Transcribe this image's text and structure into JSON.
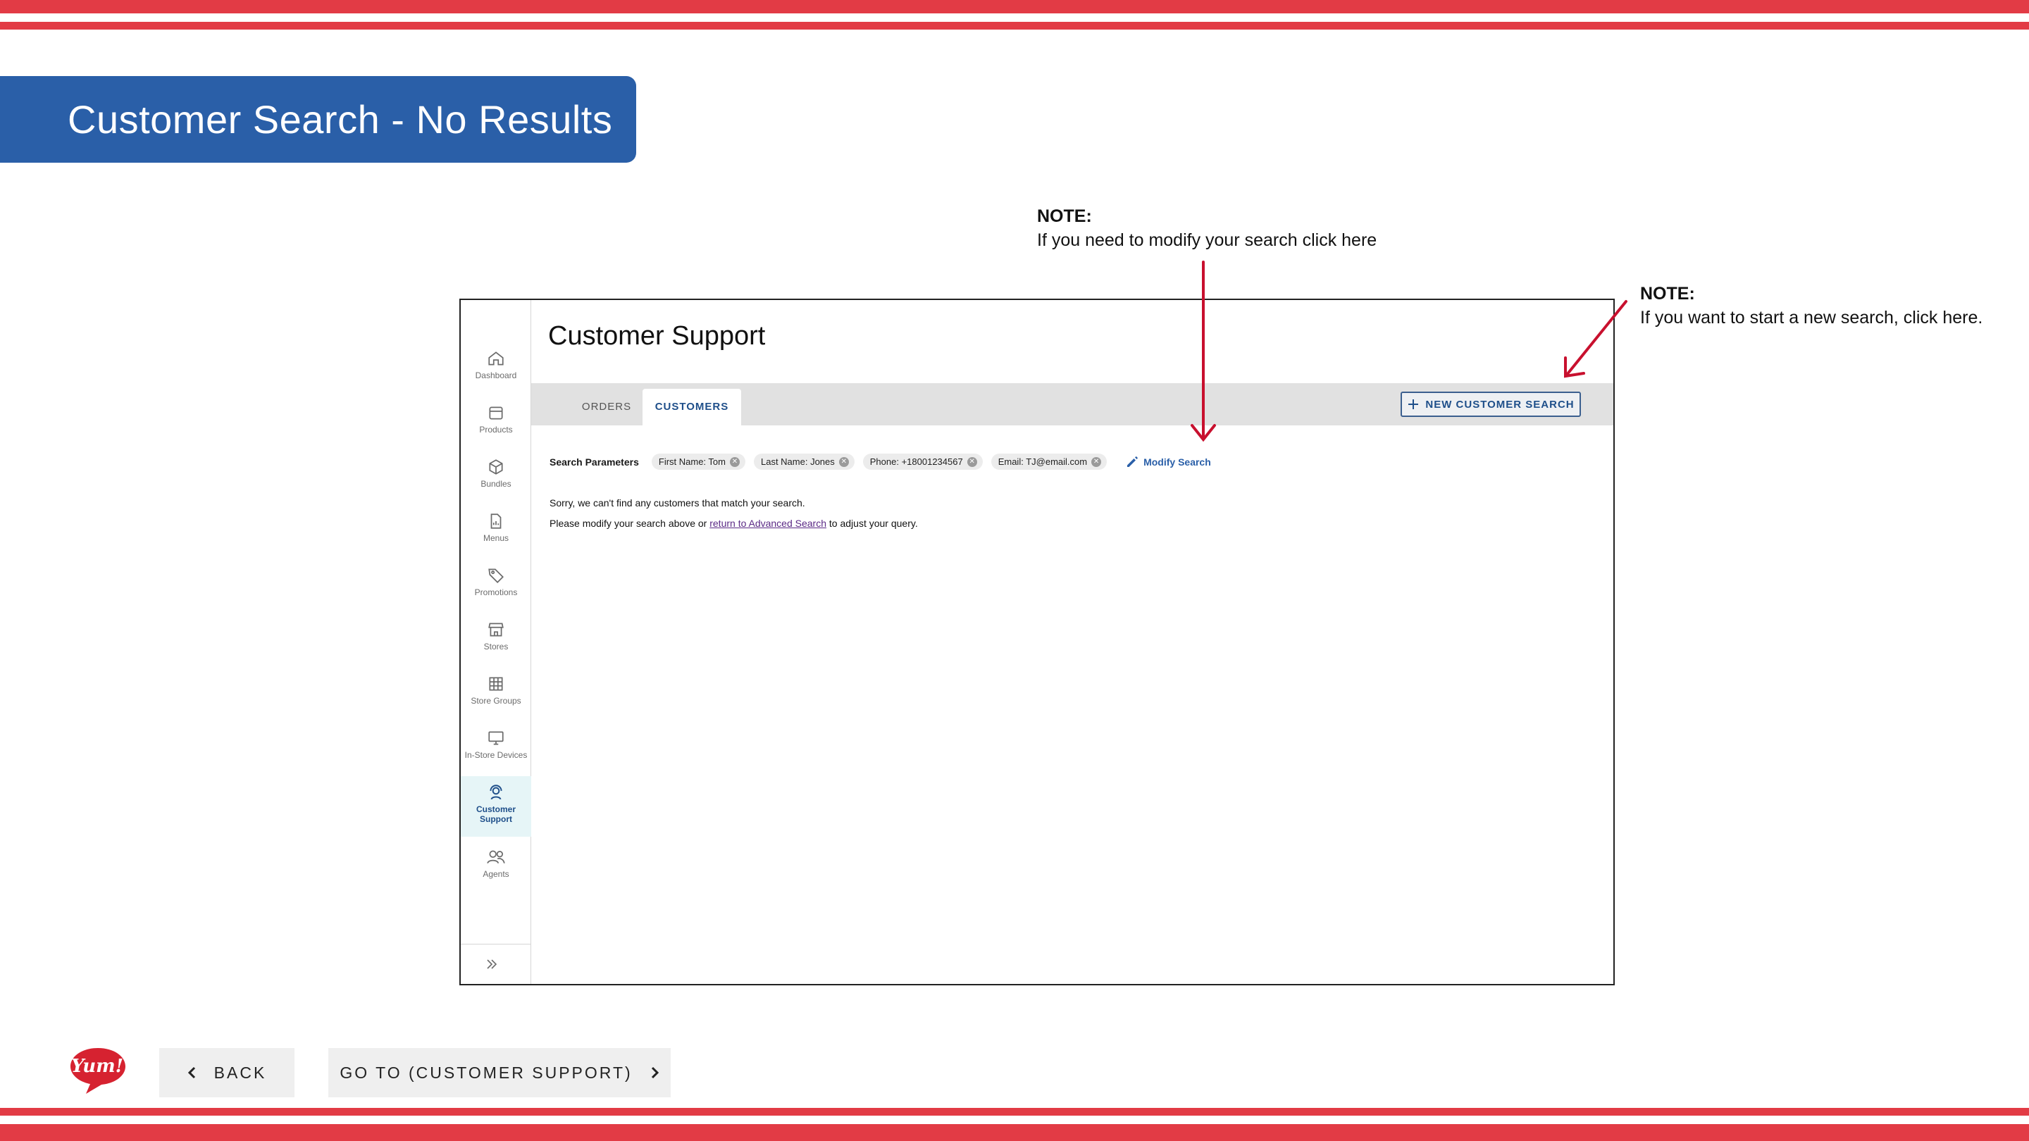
{
  "slide": {
    "title": "Customer Search - No Results",
    "notes": [
      {
        "head": "NOTE:",
        "text": "If you need to modify your search click here"
      },
      {
        "head": "NOTE:",
        "text": "If you want to start a new search, click here."
      }
    ],
    "colors": {
      "stripe": "#e23b45",
      "banner": "#2a5fa8",
      "arrow": "#c8102e"
    }
  },
  "app": {
    "sidebar": [
      {
        "label": "Dashboard",
        "icon": "home-icon"
      },
      {
        "label": "Products",
        "icon": "calendar-icon"
      },
      {
        "label": "Bundles",
        "icon": "box-icon"
      },
      {
        "label": "Menus",
        "icon": "document-icon"
      },
      {
        "label": "Promotions",
        "icon": "tag-icon"
      },
      {
        "label": "Stores",
        "icon": "store-icon"
      },
      {
        "label": "Store Groups",
        "icon": "grid-icon"
      },
      {
        "label": "In-Store Devices",
        "icon": "monitor-icon"
      },
      {
        "label_line1": "Customer",
        "label_line2": "Support",
        "icon": "headset-icon",
        "active": true
      },
      {
        "label": "Agents",
        "icon": "people-icon"
      }
    ],
    "page_title": "Customer Support",
    "tabs": [
      {
        "label": "ORDERS",
        "active": false
      },
      {
        "label": "CUSTOMERS",
        "active": true
      }
    ],
    "new_search_button": "NEW CUSTOMER SEARCH",
    "search_params_label": "Search Parameters",
    "chips": [
      "First Name: Tom",
      "Last Name: Jones",
      "Phone: +18001234567",
      "Email: TJ@email.com"
    ],
    "modify_label": "Modify Search",
    "message_line1": "Sorry, we can't find any customers that match your search.",
    "message_line2_before": "Please modify your search above or ",
    "message_link": "return to Advanced Search",
    "message_line2_after": " to adjust your query."
  },
  "footer": {
    "logo_text": "Yum!",
    "back_label": "BACK",
    "forward_label": "GO TO (CUSTOMER SUPPORT)"
  }
}
